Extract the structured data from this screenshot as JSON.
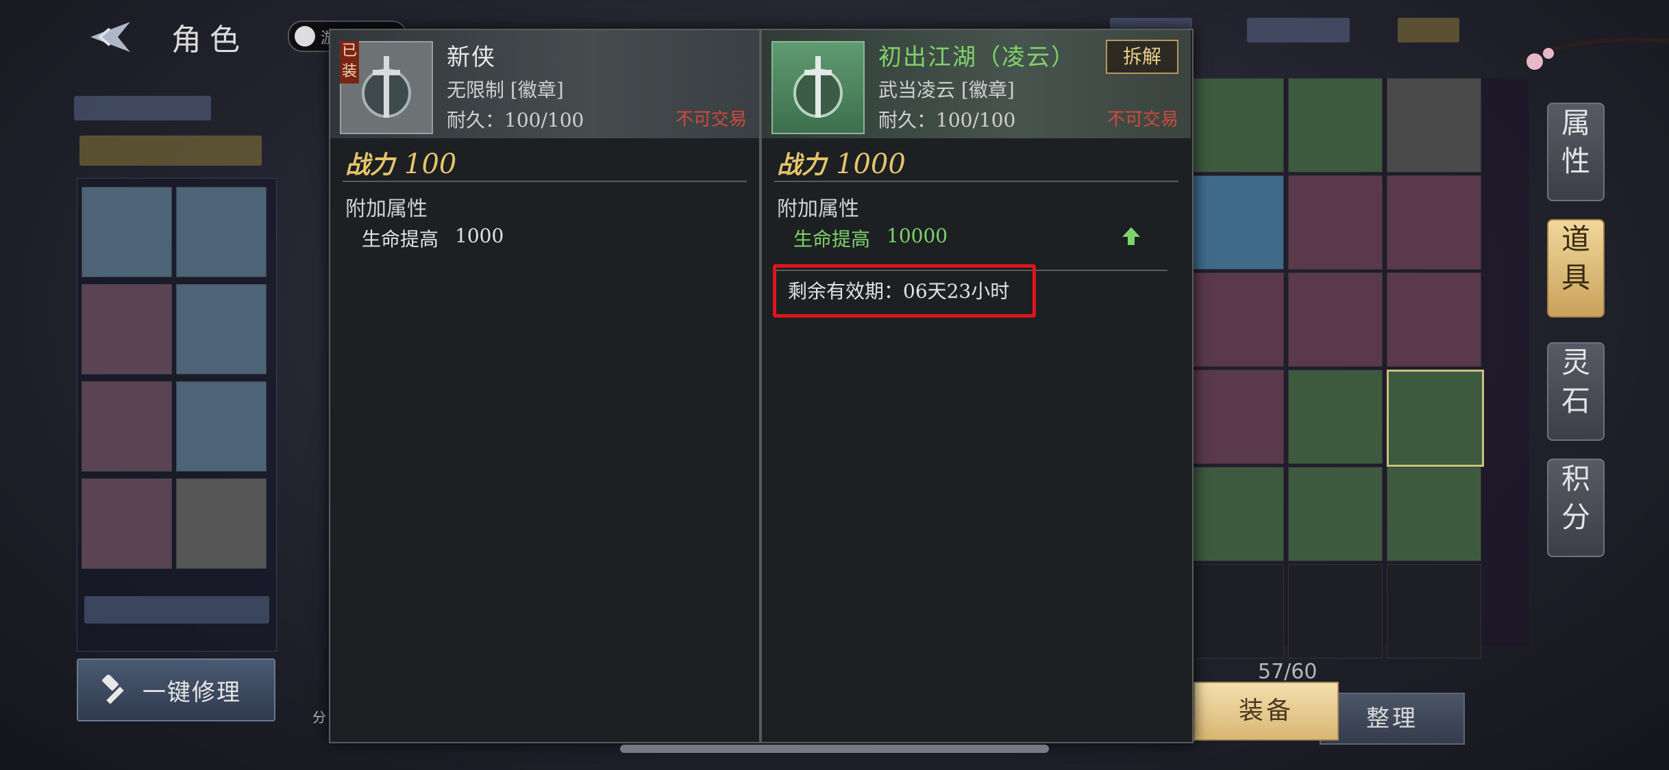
{
  "header": {
    "title": "角色",
    "guest_label": "游"
  },
  "left": {
    "repair_button": "一键修理",
    "split_label": "分"
  },
  "tooltip": {
    "equipped_item": {
      "equipped_tag": "已装",
      "name": "新侠",
      "subtitle": "无限制 [徽章]",
      "durability": "耐久：100/100",
      "trade_status": "不可交易",
      "power_label": "战力",
      "power_value": "100",
      "section_title": "附加属性",
      "attribute_name": "生命提高",
      "attribute_value": "1000"
    },
    "compare_item": {
      "name": "初出江湖（凌云）",
      "dismantle_button": "拆解",
      "subtitle": "武当凌云 [徽章]",
      "durability": "耐久：100/100",
      "trade_status": "不可交易",
      "power_label": "战力",
      "power_value": "1000",
      "section_title": "附加属性",
      "attribute_name": "生命提高",
      "attribute_value": "10000",
      "expiry": "剩余有效期：06天23小时"
    }
  },
  "inventory": {
    "capacity": "57/60",
    "tab_equip": "装备",
    "tab_sort": "整理"
  },
  "side_tabs": [
    {
      "line1": "属",
      "line2": "性"
    },
    {
      "line1": "道",
      "line2": "具"
    },
    {
      "line1": "灵",
      "line2": "石"
    },
    {
      "line1": "积",
      "line2": "分"
    }
  ],
  "colors": {
    "accent_gold": "#e6c46a",
    "green": "#7fd36a",
    "red_tag": "#d14a3c",
    "highlight": "#e0141b"
  }
}
